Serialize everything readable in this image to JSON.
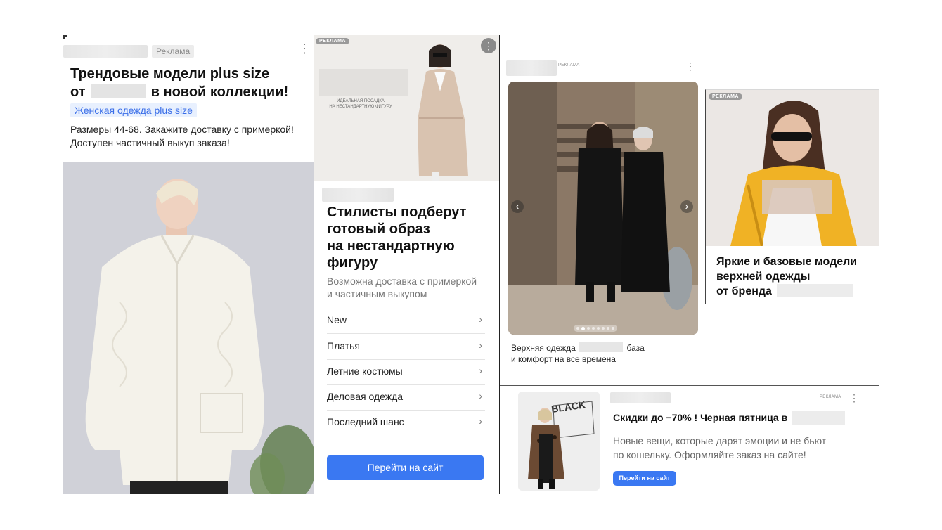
{
  "ad1": {
    "badge": "Реклама",
    "title_line1": "Трендовые модели plus size",
    "title_line2_pre": "от",
    "title_line2_post": "в новой коллекции!",
    "sitelink": "Женская одежда plus size",
    "desc_line1": "Размеры 44-68. Закажите доставку с примеркой!",
    "desc_line2": "Доступен частичный выкуп заказа!"
  },
  "ad2": {
    "badge": "РЕКЛАМА",
    "banner_line1": "ИДЕАЛЬНАЯ ПОСАДКА",
    "banner_line2": "НА НЕСТАНДАРТНУЮ ФИГУРУ",
    "title_lines": [
      "Стилисты подберут",
      "готовый образ",
      "на нестандартную",
      "фигуру"
    ],
    "desc_lines": [
      "Возможна доставка с примеркой",
      "и частичным выкупом"
    ],
    "menu": [
      {
        "label": "New"
      },
      {
        "label": "Платья"
      },
      {
        "label": "Летние костюмы"
      },
      {
        "label": "Деловая одежда"
      },
      {
        "label": "Последний шанс"
      }
    ],
    "chevron": "›",
    "cta": "Перейти на сайт"
  },
  "ad3": {
    "badge": "РЕКЛАМА",
    "prev": "‹",
    "next": "›",
    "slides_total": 8,
    "slide_active": 2,
    "caption_line1_pre": "Верхняя одежда",
    "caption_line1_post": "база",
    "caption_line2": "и комфорт на все времена"
  },
  "ad4": {
    "badge": "РЕКЛАМА",
    "title_lines": [
      "Яркие и базовые модели",
      "верхней одежды"
    ],
    "title_line3_pre": "от бренда"
  },
  "ad5": {
    "badge": "РЕКЛАМА",
    "photo_text": "BLACK",
    "title_pre": "Скидки до −70% ! Черная пятница в",
    "desc_line1": "Новые вещи, которые дарят эмоции и не бьют",
    "desc_line2": "по кошельку. Оформляйте заказ на сайте!",
    "cta": "Перейти на сайт"
  },
  "colors": {
    "accent": "#3a78f2",
    "sitelink_bg": "#e8f0fe",
    "sitelink_text": "#3a6ee8",
    "jacket": "#f0b225"
  },
  "icons": [
    "more-vertical-icon",
    "chevron-right-icon",
    "carousel-prev-icon",
    "carousel-next-icon"
  ]
}
